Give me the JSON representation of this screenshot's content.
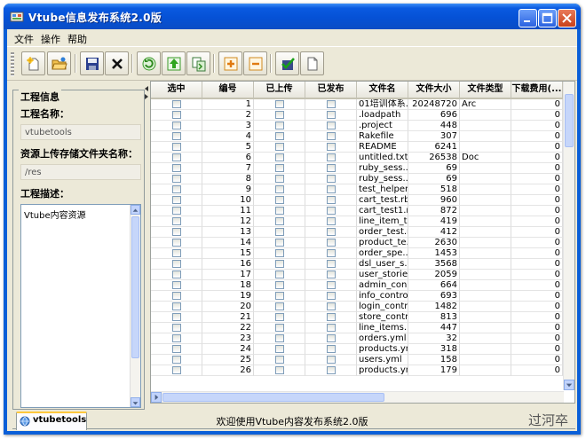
{
  "window": {
    "title": "Vtube信息发布系统2.0版"
  },
  "menu": [
    "文件",
    "操作",
    "帮助"
  ],
  "toolbar": {
    "buttons": [
      "new-project-icon",
      "open-folder-icon",
      "save-icon",
      "delete-icon",
      "refresh-icon",
      "upload-icon",
      "copy-icon",
      "add-icon",
      "remove-icon",
      "check-icon",
      "document-icon"
    ]
  },
  "left_panel": {
    "legend": "工程信息",
    "name_label": "工程名称：",
    "name_value": "vtubetools",
    "folder_label": "资源上传存储文件夹名称：",
    "folder_value": "/res",
    "desc_label": "工程描述：",
    "desc_value": "Vtube内容资源"
  },
  "table": {
    "columns": [
      "选中",
      "编号",
      "已上传",
      "已发布",
      "文件名",
      "文件大小",
      "文件类型",
      "下载费用(..."
    ],
    "rows": [
      {
        "id": "1",
        "name": "01培训体系...",
        "size": "20248720",
        "type": "Arc",
        "fee": "0"
      },
      {
        "id": "2",
        "name": ".loadpath",
        "size": "696",
        "type": "",
        "fee": "0"
      },
      {
        "id": "3",
        "name": ".project",
        "size": "448",
        "type": "",
        "fee": "0"
      },
      {
        "id": "4",
        "name": "Rakefile",
        "size": "307",
        "type": "",
        "fee": "0"
      },
      {
        "id": "5",
        "name": "README",
        "size": "6241",
        "type": "",
        "fee": "0"
      },
      {
        "id": "6",
        "name": "untitled.txt",
        "size": "26538",
        "type": "Doc",
        "fee": "0"
      },
      {
        "id": "7",
        "name": "ruby_sess....",
        "size": "69",
        "type": "",
        "fee": "0"
      },
      {
        "id": "8",
        "name": "ruby_sess....",
        "size": "69",
        "type": "",
        "fee": "0"
      },
      {
        "id": "9",
        "name": "test_helper....",
        "size": "518",
        "type": "",
        "fee": "0"
      },
      {
        "id": "10",
        "name": "cart_test.rb",
        "size": "960",
        "type": "",
        "fee": "0"
      },
      {
        "id": "11",
        "name": "cart_test1.rb",
        "size": "872",
        "type": "",
        "fee": "0"
      },
      {
        "id": "12",
        "name": "line_item_t...",
        "size": "419",
        "type": "",
        "fee": "0"
      },
      {
        "id": "13",
        "name": "order_test.rb",
        "size": "412",
        "type": "",
        "fee": "0"
      },
      {
        "id": "14",
        "name": "product_te...",
        "size": "2630",
        "type": "",
        "fee": "0"
      },
      {
        "id": "15",
        "name": "order_spe...",
        "size": "1453",
        "type": "",
        "fee": "0"
      },
      {
        "id": "16",
        "name": "dsl_user_s...",
        "size": "3568",
        "type": "",
        "fee": "0"
      },
      {
        "id": "17",
        "name": "user_storie...",
        "size": "2059",
        "type": "",
        "fee": "0"
      },
      {
        "id": "18",
        "name": "admin_con...",
        "size": "664",
        "type": "",
        "fee": "0"
      },
      {
        "id": "19",
        "name": "info_contro...",
        "size": "693",
        "type": "",
        "fee": "0"
      },
      {
        "id": "20",
        "name": "login_contr...",
        "size": "1482",
        "type": "",
        "fee": "0"
      },
      {
        "id": "21",
        "name": "store_contr...",
        "size": "813",
        "type": "",
        "fee": "0"
      },
      {
        "id": "22",
        "name": "line_items....",
        "size": "447",
        "type": "",
        "fee": "0"
      },
      {
        "id": "23",
        "name": "orders.yml",
        "size": "32",
        "type": "",
        "fee": "0"
      },
      {
        "id": "24",
        "name": "products.yml",
        "size": "318",
        "type": "",
        "fee": "0"
      },
      {
        "id": "25",
        "name": "users.yml",
        "size": "158",
        "type": "",
        "fee": "0"
      },
      {
        "id": "26",
        "name": "products.yml",
        "size": "179",
        "type": "",
        "fee": "0"
      }
    ]
  },
  "tabs": [
    "vtubetools"
  ],
  "status": "欢迎使用Vtube内容发布系统2.0版",
  "watermark": "过河卒",
  "colors": {
    "titlebar": "#0a5ae0",
    "client": "#ece9d8",
    "tab_accent": "#ffc83c"
  }
}
